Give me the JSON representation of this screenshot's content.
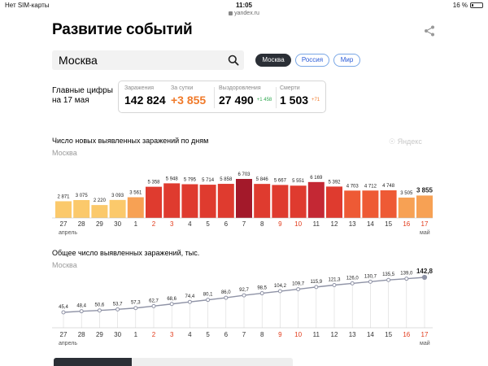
{
  "statusbar": {
    "carrier": "Нет SIM-карты",
    "time": "11:05",
    "battery": "16 %",
    "url": "yandex.ru",
    "battery_level": 0.16
  },
  "header": {
    "title": "Развитие событий"
  },
  "search": {
    "value": "Москва"
  },
  "filters": [
    {
      "label": "Москва",
      "active": true
    },
    {
      "label": "Россия",
      "active": false
    },
    {
      "label": "Мир",
      "active": false
    }
  ],
  "key_figures": {
    "label_line1": "Главные цифры",
    "label_line2": "на 17 мая",
    "infected": {
      "label": "Заражения",
      "value": "142 824"
    },
    "daily": {
      "label": "За сутки",
      "value": "+3 855"
    },
    "recovered": {
      "label": "Выздоровления",
      "value": "27 490",
      "delta": "+1 458"
    },
    "deaths": {
      "label": "Смерти",
      "value": "1 503",
      "delta": "+71"
    }
  },
  "colors": {
    "accent_orange": "#f07a2a",
    "green": "#2fa84f",
    "link_blue": "#2a5bd7",
    "weekend_red": "#e23a1a"
  },
  "watermark": "Яндекс",
  "chart_data": [
    {
      "type": "bar",
      "title": "Число новых выявленных заражений по дням",
      "subtitle": "Москва",
      "categories": [
        "27",
        "28",
        "29",
        "30",
        "1",
        "2",
        "3",
        "4",
        "5",
        "6",
        "7",
        "8",
        "9",
        "10",
        "11",
        "12",
        "13",
        "14",
        "15",
        "16",
        "17"
      ],
      "month_labels": [
        "апрель",
        "май"
      ],
      "red_categories": [
        "2",
        "3",
        "9",
        "10",
        "16",
        "17"
      ],
      "values": [
        2871,
        3075,
        2220,
        3093,
        3561,
        5358,
        5948,
        5795,
        5714,
        5858,
        6703,
        5846,
        5667,
        5551,
        6169,
        5392,
        4703,
        4712,
        4748,
        3505,
        3855
      ],
      "value_labels": [
        "2 871",
        "3 075",
        "2 220",
        "3 093",
        "3 561",
        "5 358",
        "5 948",
        "5 795",
        "5 714",
        "5 858",
        "6 703",
        "5 846",
        "5 667",
        "5 551",
        "6 169",
        "5 392",
        "4 703",
        "4 712",
        "4 748",
        "3 505",
        "3 855"
      ],
      "ylim": [
        0,
        7000
      ]
    },
    {
      "type": "line",
      "title": "Общее число выявленных заражений, тыс.",
      "subtitle": "Москва",
      "categories": [
        "27",
        "28",
        "29",
        "30",
        "1",
        "2",
        "3",
        "4",
        "5",
        "6",
        "7",
        "8",
        "9",
        "10",
        "11",
        "12",
        "13",
        "14",
        "15",
        "16",
        "17"
      ],
      "month_labels": [
        "апрель",
        "май"
      ],
      "red_categories": [
        "2",
        "3",
        "9",
        "10",
        "16",
        "17"
      ],
      "values": [
        45.4,
        48.4,
        50.6,
        53.7,
        57.3,
        62.7,
        68.6,
        74.4,
        80.1,
        86.0,
        92.7,
        98.5,
        104.2,
        109.7,
        115.9,
        121.3,
        126.0,
        130.7,
        135.5,
        139.0,
        142.8
      ],
      "value_labels": [
        "45,4",
        "48,4",
        "50,6",
        "53,7",
        "57,3",
        "62,7",
        "68,6",
        "74,4",
        "80,1",
        "86,0",
        "92,7",
        "98,5",
        "104,2",
        "109,7",
        "115,9",
        "121,3",
        "126,0",
        "130,7",
        "135,5",
        "139,0",
        "142,8"
      ],
      "ylim": [
        0,
        150
      ]
    }
  ]
}
